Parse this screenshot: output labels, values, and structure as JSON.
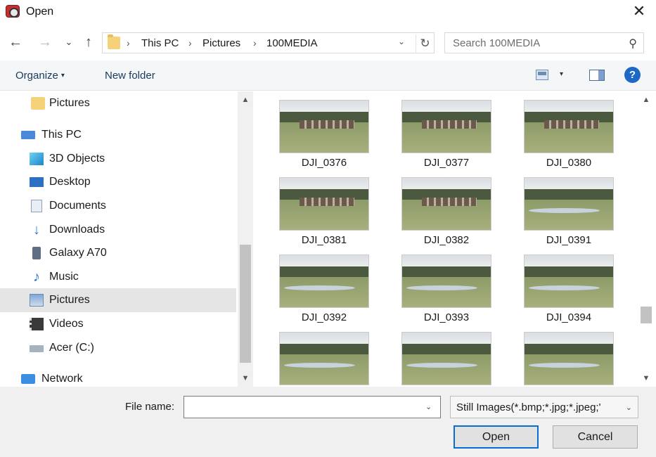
{
  "window": {
    "title": "Open",
    "close_glyph": "✕"
  },
  "nav": {
    "back": "←",
    "forward": "→",
    "recent": "⌄",
    "up": "↑"
  },
  "address": {
    "crumbs": [
      "This PC",
      "Pictures",
      "100MEDIA"
    ],
    "separator": "›",
    "dropdown": "⌄",
    "refresh": "↻"
  },
  "search": {
    "placeholder": "Search 100MEDIA",
    "icon": "⚲"
  },
  "toolbar": {
    "organize": "Organize",
    "caret": "▾",
    "new_folder": "New folder",
    "help": "?"
  },
  "sidebar": {
    "items": [
      {
        "label": "Pictures",
        "icon": "folder-icon"
      },
      {
        "label": "This PC",
        "icon": "computer-icon"
      },
      {
        "label": "3D Objects",
        "icon": "3d-objects-icon"
      },
      {
        "label": "Desktop",
        "icon": "desktop-icon"
      },
      {
        "label": "Documents",
        "icon": "documents-icon"
      },
      {
        "label": "Downloads",
        "icon": "downloads-icon",
        "glyph": "↓"
      },
      {
        "label": "Galaxy A70",
        "icon": "phone-icon"
      },
      {
        "label": "Music",
        "icon": "music-icon",
        "glyph": "♪"
      },
      {
        "label": "Pictures",
        "icon": "pictures-icon"
      },
      {
        "label": "Videos",
        "icon": "videos-icon"
      },
      {
        "label": "Acer (C:)",
        "icon": "drive-icon"
      },
      {
        "label": "Network",
        "icon": "network-icon"
      }
    ],
    "selected": "Pictures"
  },
  "scroll": {
    "up": "▲",
    "down": "▼"
  },
  "files": [
    {
      "name": "DJI_0376"
    },
    {
      "name": "DJI_0377"
    },
    {
      "name": "DJI_0380"
    },
    {
      "name": "DJI_0381"
    },
    {
      "name": "DJI_0382"
    },
    {
      "name": "DJI_0391"
    },
    {
      "name": "DJI_0392"
    },
    {
      "name": "DJI_0393"
    },
    {
      "name": "DJI_0394"
    },
    {
      "name": ""
    },
    {
      "name": ""
    },
    {
      "name": ""
    }
  ],
  "footer": {
    "file_name_label": "File name:",
    "file_name_value": "",
    "dropdown": "⌄",
    "file_type": "Still Images(*.bmp;*.jpg;*.jpeg;'",
    "open_label": "Open",
    "cancel_label": "Cancel"
  }
}
